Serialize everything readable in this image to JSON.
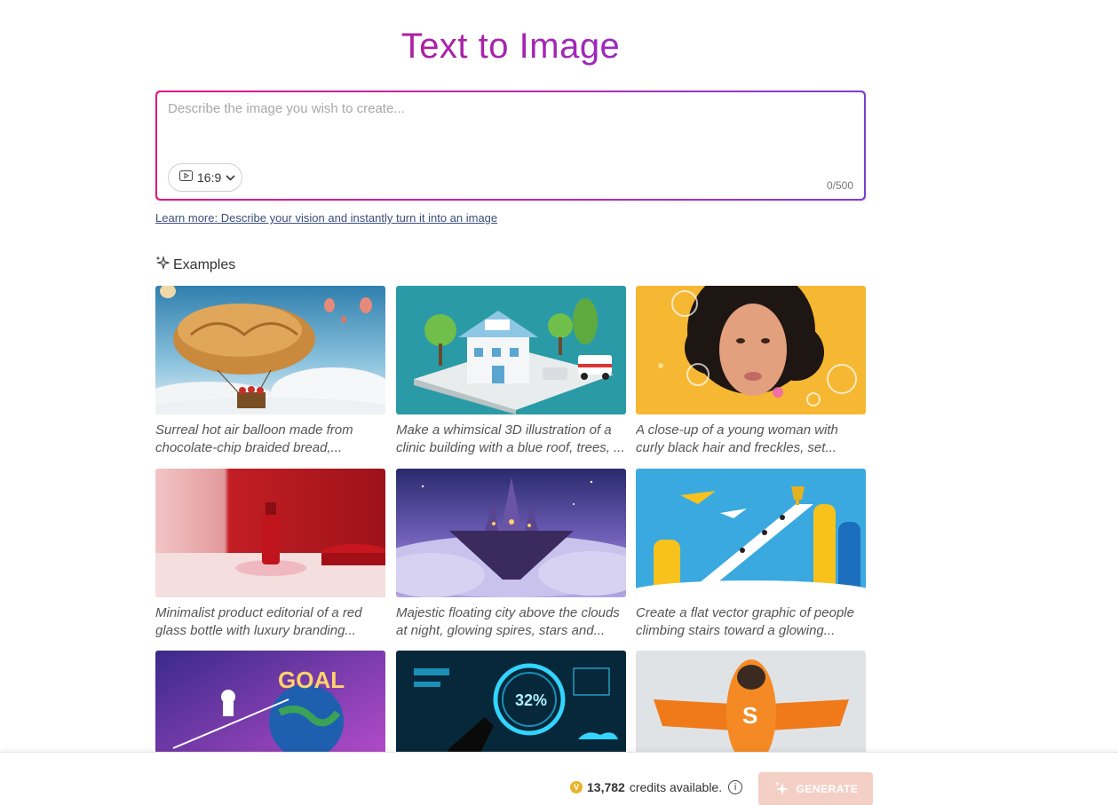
{
  "header": {
    "title": "Text to Image"
  },
  "prompt": {
    "placeholder": "Describe the image you wish to create...",
    "value": "",
    "aspect_ratio": "16:9",
    "char_count": "0/500"
  },
  "learn_more": {
    "label": "Learn more: Describe your vision and instantly turn it into an image"
  },
  "examples": {
    "label": "Examples",
    "items": [
      {
        "caption": "Surreal hot air balloon made from chocolate-chip braided bread,..."
      },
      {
        "caption": "Make a whimsical 3D illustration of a clinic building with a blue roof, trees, ..."
      },
      {
        "caption": "A close-up of a young woman with curly black hair and freckles, set..."
      },
      {
        "caption": "Minimalist product editorial of a red glass bottle with luxury branding..."
      },
      {
        "caption": "Majestic floating city above the clouds at night, glowing spires, stars and..."
      },
      {
        "caption": "Create a flat vector graphic of people climbing stairs toward a glowing..."
      },
      {
        "caption": ""
      },
      {
        "caption": ""
      },
      {
        "caption": ""
      }
    ]
  },
  "footer": {
    "credits_number": "13,782",
    "credits_suffix": "credits available.",
    "generate_label": "GENERATE"
  },
  "colors": {
    "title_gradient_start": "#c0147f",
    "title_gradient_end": "#7b3fd0",
    "generate_bg_disabled": "#f4cfc6",
    "link": "#3b4f7c"
  }
}
